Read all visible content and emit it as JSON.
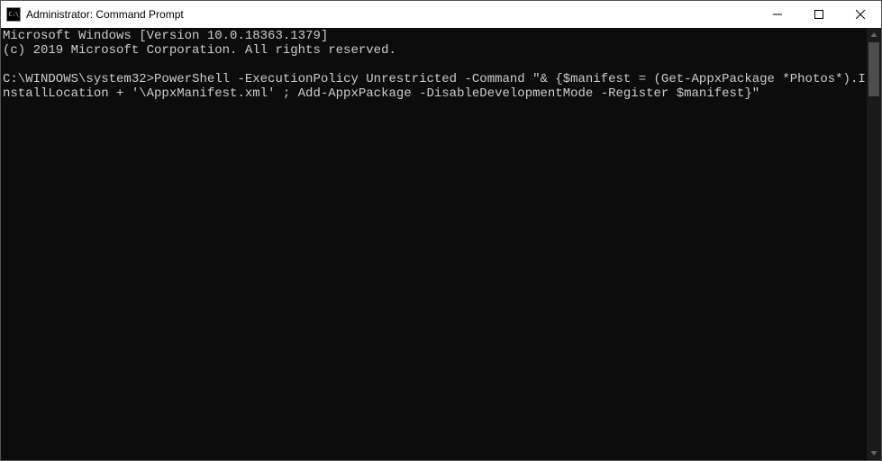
{
  "window": {
    "title": "Administrator: Command Prompt",
    "icon_label": "C:\\"
  },
  "terminal": {
    "line1": "Microsoft Windows [Version 10.0.18363.1379]",
    "line2": "(c) 2019 Microsoft Corporation. All rights reserved.",
    "blank1": "",
    "prompt_path": "C:\\WINDOWS\\system32>",
    "command": "PowerShell -ExecutionPolicy Unrestricted -Command \"& {$manifest = (Get-AppxPackage *Photos*).InstallLocation + '\\AppxManifest.xml' ; Add-AppxPackage -DisableDevelopmentMode -Register $manifest}\""
  }
}
